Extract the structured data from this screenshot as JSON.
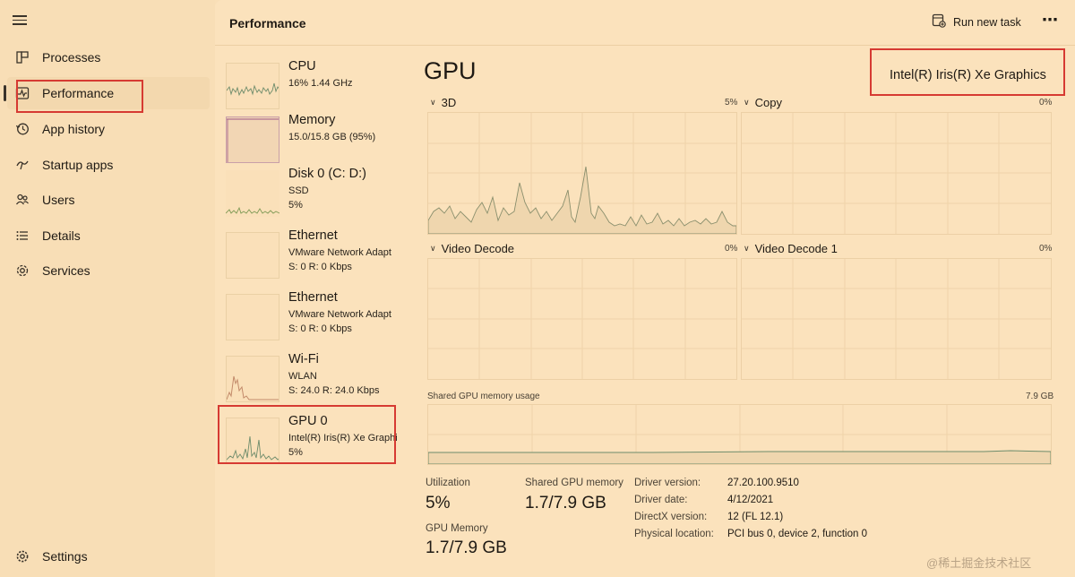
{
  "nav": {
    "items": [
      {
        "label": "Processes",
        "icon": "processes-icon"
      },
      {
        "label": "Performance",
        "icon": "performance-icon"
      },
      {
        "label": "App history",
        "icon": "app-history-icon"
      },
      {
        "label": "Startup apps",
        "icon": "startup-apps-icon"
      },
      {
        "label": "Users",
        "icon": "users-icon"
      },
      {
        "label": "Details",
        "icon": "details-icon"
      },
      {
        "label": "Services",
        "icon": "services-icon"
      }
    ],
    "settings_label": "Settings"
  },
  "header": {
    "title": "Performance",
    "run_task_label": "Run new task",
    "more_label": "⋯"
  },
  "devices": [
    {
      "name": "CPU",
      "sub1": "16%  1.44 GHz",
      "sub2": ""
    },
    {
      "name": "Memory",
      "sub1": "15.0/15.8 GB (95%)",
      "sub2": ""
    },
    {
      "name": "Disk 0 (C: D:)",
      "sub1": "SSD",
      "sub2": "5%"
    },
    {
      "name": "Ethernet",
      "sub1": "VMware Network Adapt",
      "sub2": "S: 0  R: 0 Kbps"
    },
    {
      "name": "Ethernet",
      "sub1": "VMware Network Adapt",
      "sub2": "S: 0  R: 0 Kbps"
    },
    {
      "name": "Wi-Fi",
      "sub1": "WLAN",
      "sub2": "S: 24.0  R: 24.0 Kbps"
    },
    {
      "name": "GPU 0",
      "sub1": "Intel(R) Iris(R) Xe Graphi",
      "sub2": "5%"
    }
  ],
  "gpu": {
    "title": "GPU",
    "model": "Intel(R) Iris(R) Xe Graphics",
    "graphs": [
      {
        "label": "3D",
        "percent": "5%"
      },
      {
        "label": "Copy",
        "percent": "0%"
      },
      {
        "label": "Video Decode",
        "percent": "0%"
      },
      {
        "label": "Video Decode 1",
        "percent": "0%"
      }
    ],
    "shared_label": "Shared GPU memory usage",
    "shared_max": "7.9 GB",
    "stats": {
      "utilization_label": "Utilization",
      "utilization_value": "5%",
      "shared_mem_label": "Shared GPU memory",
      "shared_mem_value": "1.7/7.9 GB",
      "gpu_mem_label": "GPU Memory",
      "gpu_mem_value": "1.7/7.9 GB"
    },
    "info": [
      {
        "label": "Driver version:",
        "value": "27.20.100.9510"
      },
      {
        "label": "Driver date:",
        "value": "4/12/2021"
      },
      {
        "label": "DirectX version:",
        "value": "12 (FL 12.1)"
      },
      {
        "label": "Physical location:",
        "value": "PCI bus 0, device 2, function 0"
      }
    ]
  },
  "watermark": "@稀土掘金技术社区",
  "colors": {
    "accent": "#d63a32",
    "graph_line": "#6e8c6b"
  }
}
